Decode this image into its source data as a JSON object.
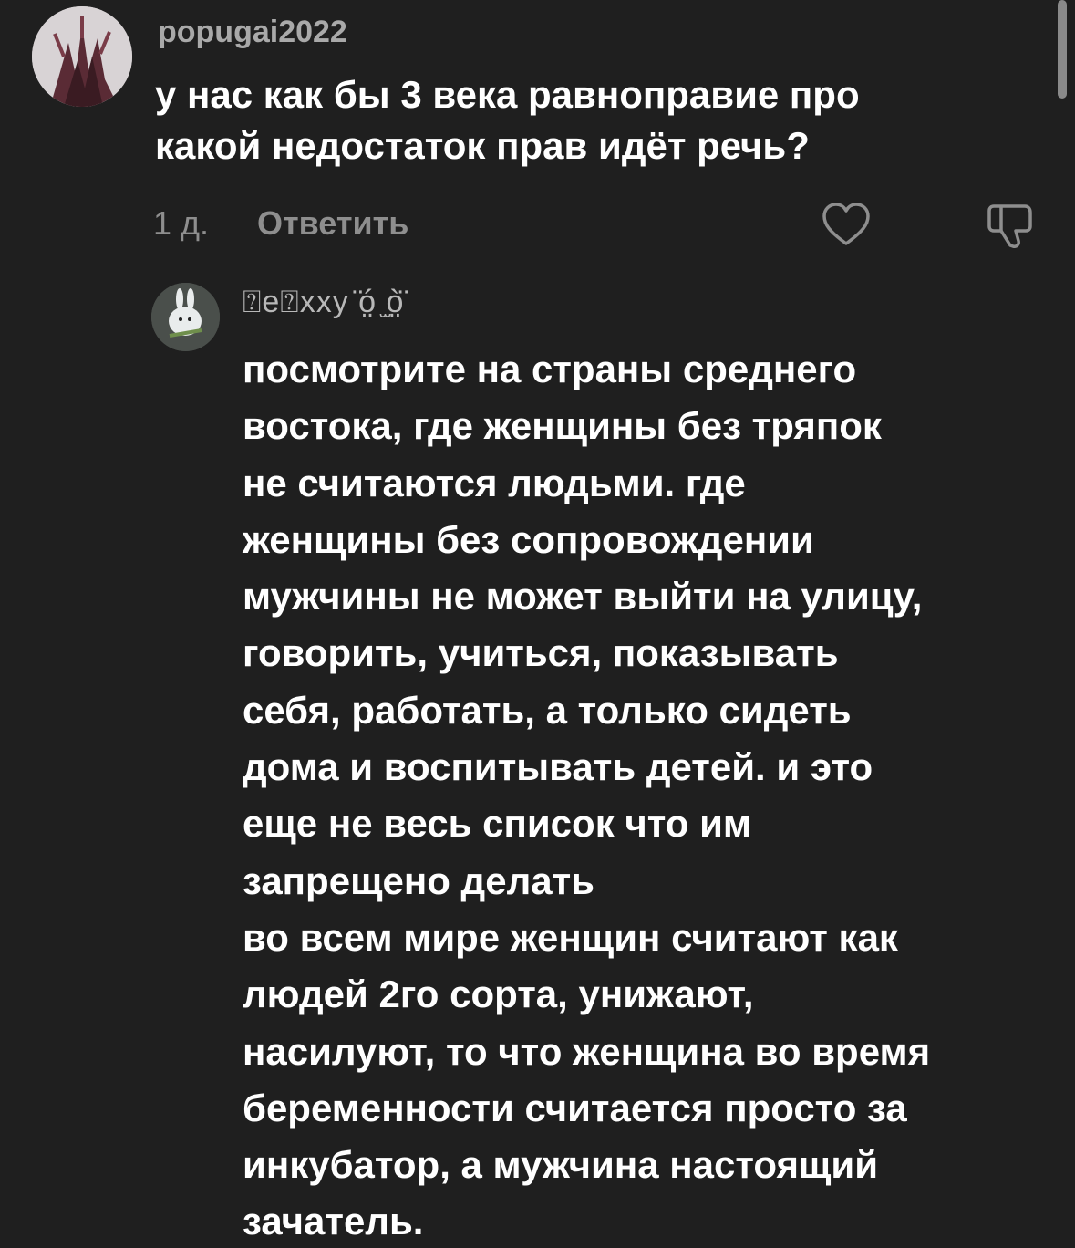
{
  "comment": {
    "username": "popugai2022",
    "text_lines": [
      "у нас как бы 3 века равноправие про",
      "какой недостаток прав идёт речь?"
    ],
    "time": "1 д.",
    "reply_label": "Ответить",
    "like_icon": "heart-outline-icon",
    "dislike_icon": "thumbs-down-outline-icon"
  },
  "reply": {
    "username": "⍰e⍰xxy ̈ó̤ ̫ò̤̈",
    "text_lines": [
      "посмотрите на страны среднего",
      "востока, где женщины без тряпок",
      "не считаются людьми. где",
      "женщины без сопровождении",
      "мужчины не может выйти на улицу,",
      "говорить, учиться, показывать",
      "себя, работать, а только сидеть",
      "дома и воспитывать детей. и это",
      "еще не весь список что им",
      "запрещено делать",
      "во всем мире женщин считают как",
      "людей 2го сорта, унижают,",
      "насилуют, то что женщина во время",
      "беременности считается просто за",
      "инкубатор, а мужчина настоящий",
      "зачатель."
    ]
  },
  "colors": {
    "background": "#1f1f1f",
    "primary_text": "#ffffff",
    "secondary_text": "#8e8e8e",
    "username_text": "#a9a9a9"
  }
}
